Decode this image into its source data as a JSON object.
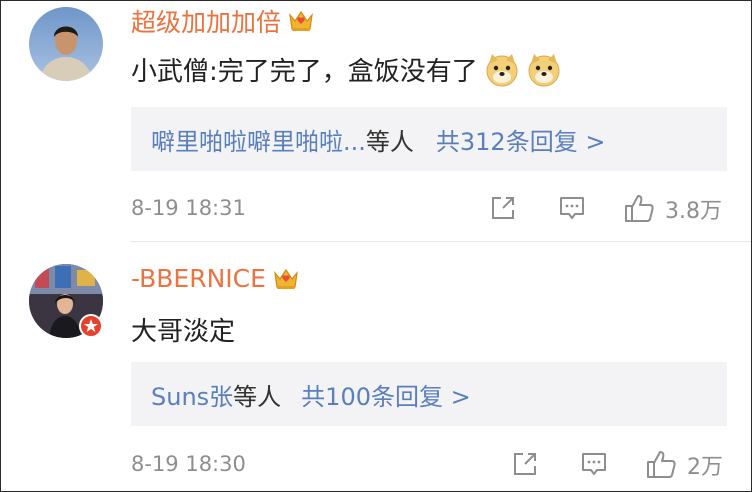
{
  "comments": [
    {
      "username": "超级加加加倍",
      "text": "小武僧:完了完了，盒饭没有了",
      "emoji_count": 2,
      "reply_users": "噼里啪啦噼里啪啦...",
      "reply_suffix": "等人",
      "reply_count": "共312条回复 >",
      "time": "8-19 18:31",
      "likes": "3.8万"
    },
    {
      "username": "-BBERNICE",
      "text": "大哥淡定",
      "reply_users": "Suns张",
      "reply_suffix": "等人",
      "reply_count": "共100条回复 >",
      "time": "8-19 18:30",
      "likes": "2万"
    }
  ],
  "colors": {
    "username": "#eb7340",
    "link": "#5a7fbd",
    "meta": "#8e8e8e",
    "reply_bg": "#f3f3f5"
  },
  "icons": [
    "crown-icon",
    "doge-emoji",
    "share-icon",
    "comment-icon",
    "like-icon",
    "verified-badge-icon"
  ]
}
